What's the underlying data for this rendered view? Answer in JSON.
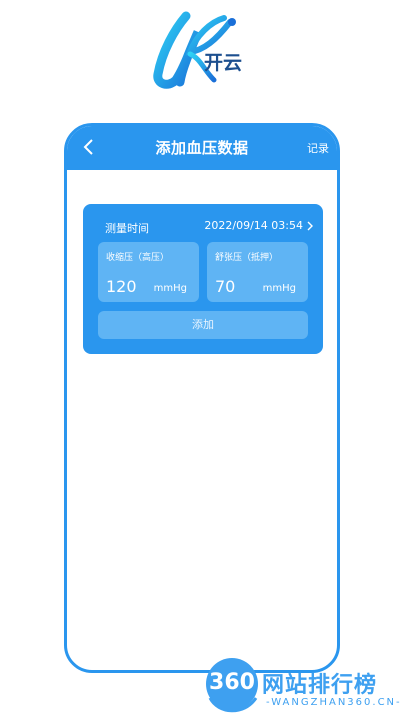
{
  "logo": {
    "text": "开云"
  },
  "header": {
    "title": "添加血压数据",
    "right_action": "记录"
  },
  "form": {
    "time_label": "测量时间",
    "time_value": "2022/09/14 03:54",
    "systolic": {
      "label": "收缩压（高压）",
      "value": "120",
      "unit": "mmHg"
    },
    "diastolic": {
      "label": "舒张压（抵押）",
      "value": "70",
      "unit": "mmHg"
    },
    "submit_label": "添加"
  },
  "watermark": {
    "badge": "360",
    "cn": "网站排行榜",
    "en": "-WANGZHAN360.CN-"
  },
  "colors": {
    "primary": "#2a96ee",
    "field_bg": "#5fb4f4",
    "watermark": "#3ea0f0"
  }
}
